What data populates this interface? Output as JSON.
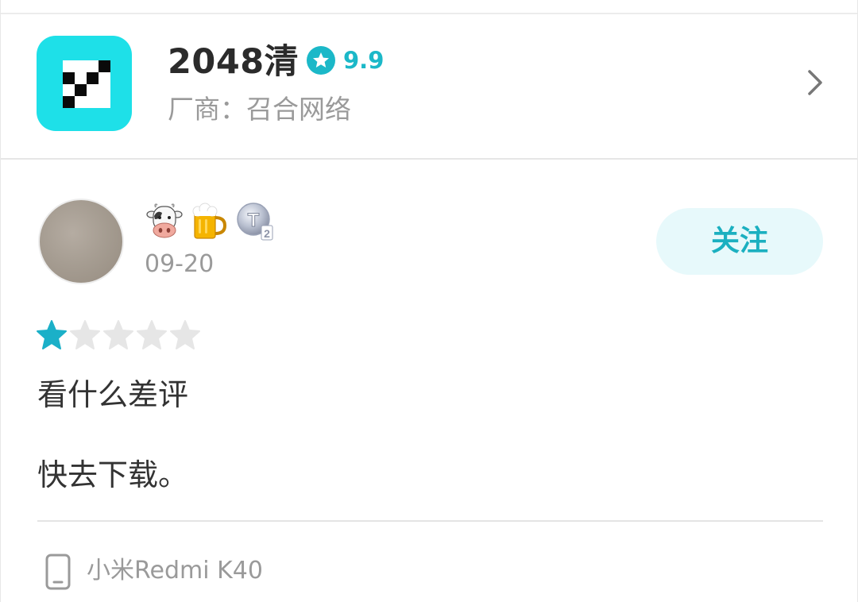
{
  "app": {
    "name": "2048清",
    "rating": "9.9",
    "vendor": "厂商：召合网络",
    "icon": "2048-grid-icon",
    "accent_color": "#1bb8c8",
    "icon_bg_color": "#1ee0e8"
  },
  "review": {
    "badges": [
      "cow-icon",
      "beer-icon",
      "t2-level-badge"
    ],
    "date": "09-20",
    "follow_label": "关注",
    "stars_total": 5,
    "stars_filled": 1,
    "text_lines": [
      "看什么差评",
      "快去下载。"
    ],
    "device": "小米Redmi K40"
  }
}
